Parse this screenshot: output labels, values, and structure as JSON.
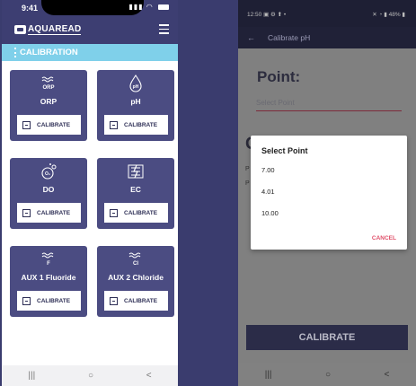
{
  "left_phone": {
    "status": {
      "time": "9:41"
    },
    "header": {
      "logo_text": "AQUAREAD"
    },
    "section_bar": {
      "title": "CALIBRATION"
    },
    "tiles": [
      {
        "label": "ORP",
        "icon_text": "ORP",
        "button": "CALIBRATE",
        "icon": "wave-orp-icon"
      },
      {
        "label": "pH",
        "icon_text": "pH",
        "button": "CALIBRATE",
        "icon": "drop-ph-icon"
      },
      {
        "label": "DO",
        "icon_text": "O₂",
        "button": "CALIBRATE",
        "icon": "bubble-do-icon"
      },
      {
        "label": "EC",
        "icon_text": "",
        "button": "CALIBRATE",
        "icon": "ec-icon"
      },
      {
        "label": "AUX 1 Fluoride",
        "icon_text": "F",
        "button": "CALIBRATE",
        "icon": "wave-fluoride-icon"
      },
      {
        "label": "AUX 2 Chloride",
        "icon_text": "Cl",
        "button": "CALIBRATE",
        "icon": "wave-chloride-icon"
      }
    ],
    "navbar": {
      "left": "|||",
      "center": "○",
      "right": "<"
    }
  },
  "right_phone": {
    "status": {
      "time": "12:50",
      "battery": "48%"
    },
    "appbar": {
      "title": "Calibrate pH",
      "back_glyph": "←"
    },
    "point_label": "Point:",
    "select_placeholder": "Select Point",
    "background_fragments": {
      "c": "C",
      "p1": "P",
      "p2": "P"
    },
    "dialog": {
      "title": "Select Point",
      "options": [
        "7.00",
        "4.01",
        "10.00"
      ],
      "cancel": "CANCEL"
    },
    "calibrate_button": "CALIBRATE",
    "navbar": {
      "left": "|||",
      "center": "○",
      "right": "<"
    }
  },
  "colors": {
    "background": "#3a3c6e",
    "brand_navy": "#3d3e72",
    "tile": "#4b4c82",
    "section_bar": "#7fd0ea",
    "cancel_accent": "#e0506a"
  }
}
